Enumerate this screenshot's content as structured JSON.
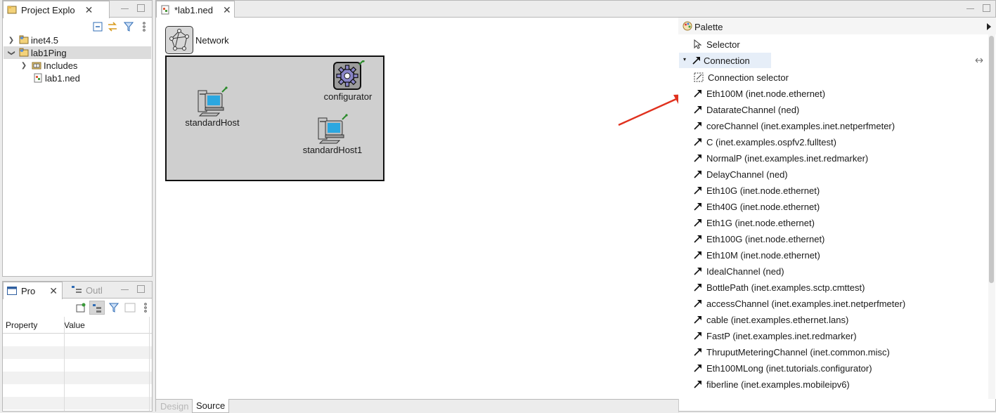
{
  "project_explorer": {
    "tab_label": "Project Explo",
    "tree": [
      {
        "label": "inet4.5",
        "expanded": false,
        "icon": "project-folder-icon"
      },
      {
        "label": "lab1Ping",
        "expanded": true,
        "icon": "project-folder-icon",
        "selected": true
      },
      {
        "label": "Includes",
        "expanded": false,
        "icon": "includes-icon"
      },
      {
        "label": "lab1.ned",
        "icon": "ned-file-icon"
      }
    ]
  },
  "properties": {
    "tab_label": "Pro",
    "outline_tab_label": "Outl",
    "columns": [
      "Property",
      "Value"
    ]
  },
  "editor": {
    "tab_label": "*lab1.ned",
    "network_label": "Network",
    "nodes": [
      {
        "name": "standardHost",
        "icon": "computer-icon"
      },
      {
        "name": "configurator",
        "icon": "gear-icon"
      },
      {
        "name": "standardHost1",
        "icon": "computer-icon"
      }
    ],
    "bottom_tabs": [
      "Design",
      "Source"
    ]
  },
  "palette": {
    "title": "Palette",
    "selector": "Selector",
    "connection_group": "Connection",
    "connection_selector": "Connection selector",
    "items": [
      "Eth100M (inet.node.ethernet)",
      "DatarateChannel (ned)",
      "coreChannel (inet.examples.inet.netperfmeter)",
      "C (inet.examples.ospfv2.fulltest)",
      "NormalP (inet.examples.inet.redmarker)",
      "DelayChannel (ned)",
      "Eth10G (inet.node.ethernet)",
      "Eth40G (inet.node.ethernet)",
      "Eth1G (inet.node.ethernet)",
      "Eth100G (inet.node.ethernet)",
      "Eth10M (inet.node.ethernet)",
      "IdealChannel (ned)",
      "BottlePath (inet.examples.sctp.cmttest)",
      "accessChannel (inet.examples.inet.netperfmeter)",
      "cable (inet.examples.ethernet.lans)",
      "FastP (inet.examples.inet.redmarker)",
      "ThruputMeteringChannel (inet.common.misc)",
      "Eth100MLong (inet.tutorials.configurator)",
      "fiberline (inet.examples.mobileipv6)"
    ]
  },
  "colors": {
    "annotation_arrow": "#e0311e",
    "network_fill": "#cfcfcf",
    "selection": "#dcdcdc"
  }
}
